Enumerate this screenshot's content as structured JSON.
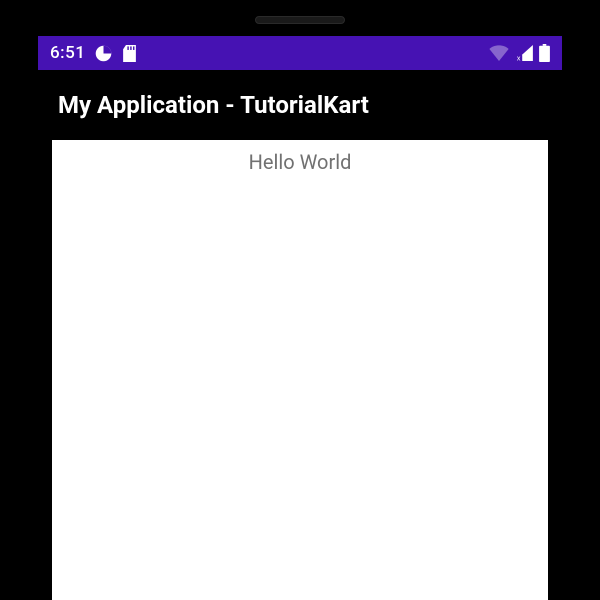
{
  "colors": {
    "status_bar_bg": "#4612b3",
    "app_bar_bg": "#000000",
    "content_bg": "#ffffff",
    "text_muted": "#717171"
  },
  "status_bar": {
    "time": "6:51",
    "icons": {
      "pie": "pie-chart-icon",
      "sd": "sd-card-icon",
      "wifi": "wifi-icon",
      "signal": "cellular-signal-icon",
      "signal_badge": "x",
      "battery": "battery-full-icon"
    }
  },
  "app_bar": {
    "title": "My Application - TutorialKart"
  },
  "content": {
    "greeting": "Hello World"
  }
}
